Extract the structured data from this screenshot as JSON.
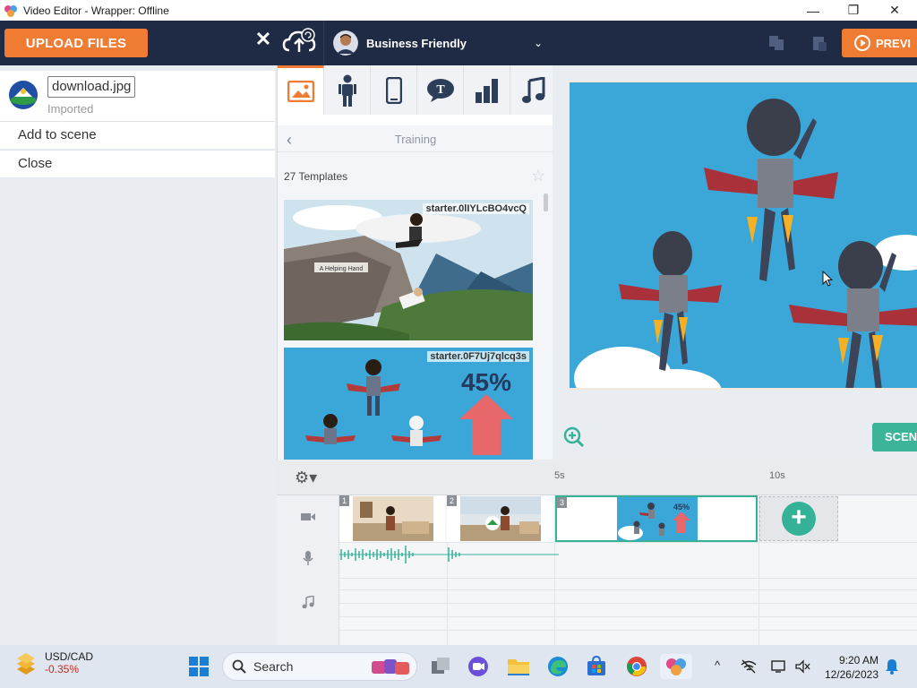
{
  "window": {
    "title": "Video Editor - Wrapper: Offline",
    "minimize": "—",
    "maximize": "❐",
    "close": "✕"
  },
  "topbar": {
    "upload_label": "UPLOAD FILES",
    "close_label": "✕",
    "theme_name": "Business Friendly",
    "theme_chevron": "⌄",
    "preview_label": "PREVI"
  },
  "asset": {
    "filename": "download.jpg",
    "status": "Imported",
    "menu": [
      "Add to scene",
      "Close"
    ]
  },
  "library": {
    "tabs": [
      "image-tab",
      "character-tab",
      "props-tab",
      "speech-tab",
      "chart-tab",
      "music-tab"
    ],
    "back": "‹",
    "category": "Training",
    "count_label": "27 Templates",
    "star": "☆",
    "templates": [
      {
        "id": "starter.0lIYLcBO4vcQ",
        "caption": "A Helping Hand"
      },
      {
        "id": "starter.0F7Uj7qlcq3s",
        "caption": "45%"
      }
    ]
  },
  "stage": {
    "scene_button": "SCEN"
  },
  "timeline": {
    "settings": "⚙▾",
    "ticks": [
      "5s",
      "10s"
    ],
    "clip_numbers": [
      "1",
      "2",
      "3"
    ],
    "rows": [
      "video-row",
      "voice-row",
      "music-row"
    ],
    "add_scene": "+"
  },
  "taskbar": {
    "ticker_pair": "USD/CAD",
    "ticker_change": "-0.35%",
    "search_placeholder": "Search",
    "time": "9:20 AM",
    "date": "12/26/2023",
    "tray_up": "^"
  },
  "colors": {
    "accent_orange": "#f07c33",
    "nav_dark": "#1f2a44",
    "teal": "#35b198",
    "stage_blue": "#3aa7d8"
  }
}
